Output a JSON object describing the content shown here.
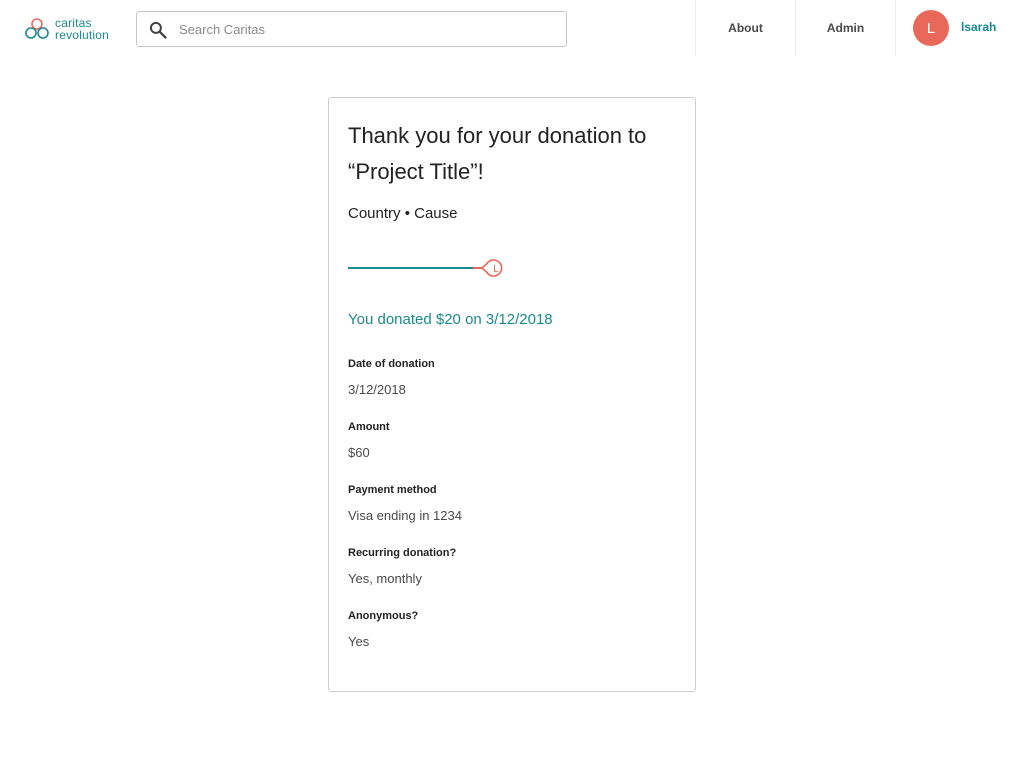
{
  "header": {
    "logo": {
      "line1": "caritas",
      "line2": "revolution"
    },
    "search": {
      "placeholder": "Search Caritas",
      "value": ""
    },
    "nav": {
      "about": "About",
      "admin": "Admin"
    },
    "user": {
      "initial": "L",
      "name": "lsarah"
    }
  },
  "card": {
    "title": "Thank you for your donation to “Project Title”!",
    "subtitle": "Country • Cause",
    "progress_avatar_initial": "L",
    "donated_message": "You donated $20 on 3/12/2018",
    "fields": [
      {
        "label": "Date of donation",
        "value": "3/12/2018"
      },
      {
        "label": "Amount",
        "value": "$60"
      },
      {
        "label": "Payment method",
        "value": "Visa ending in 1234"
      },
      {
        "label": "Recurring donation?",
        "value": "Yes, monthly"
      },
      {
        "label": "Anonymous?",
        "value": "Yes"
      }
    ]
  },
  "colors": {
    "accent": "#1a8a8f",
    "brand_coral": "#e8695a",
    "text_dark": "#222222",
    "text_muted": "#4a4a4a"
  },
  "icons": {
    "logo": "caritas-logo-icon",
    "search": "search-icon",
    "progress_marker": "user-marker-icon"
  }
}
